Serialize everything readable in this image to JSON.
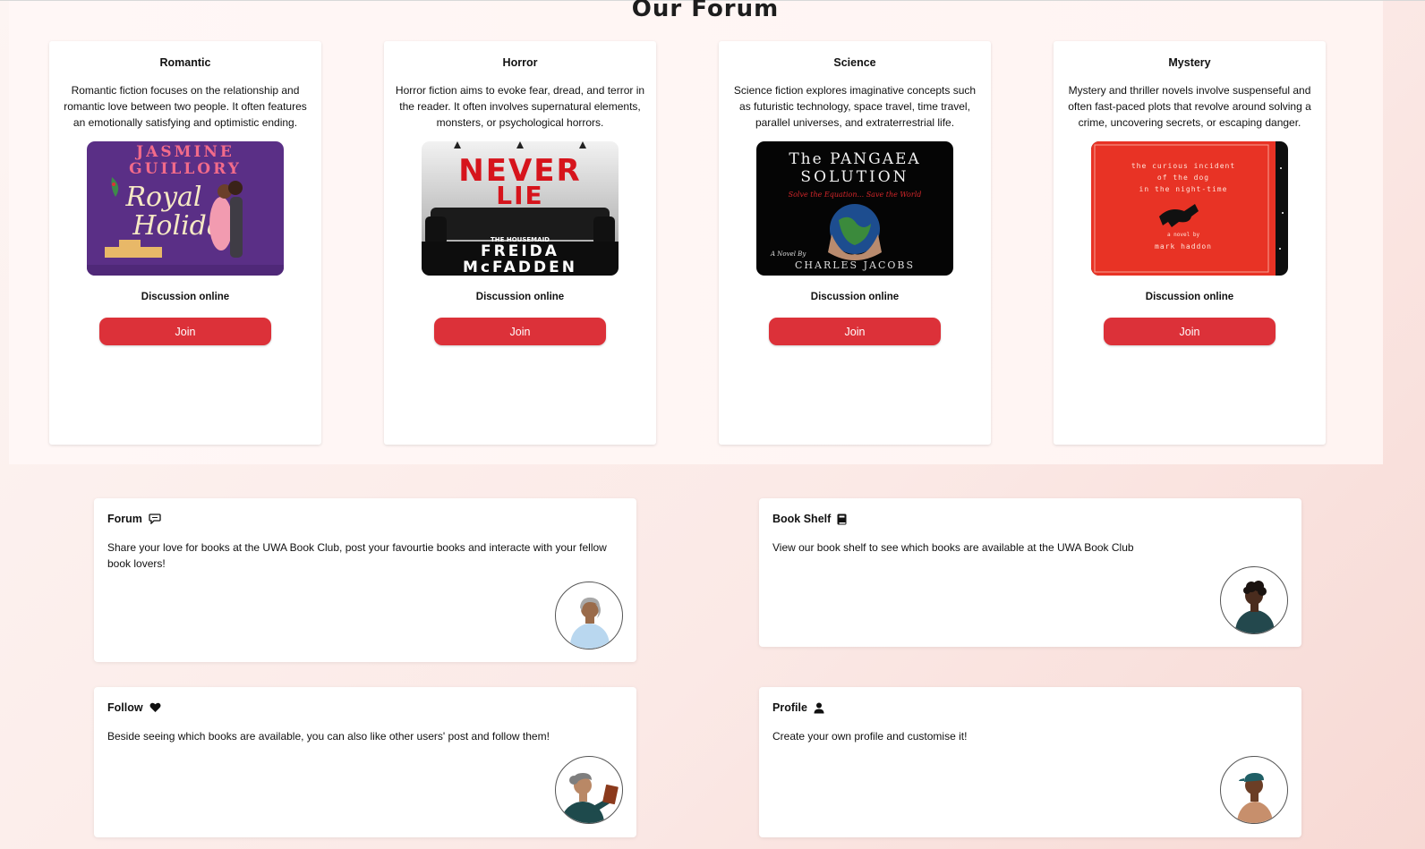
{
  "forum_section": {
    "title": "Our Forum",
    "genres": [
      {
        "title": "Romantic",
        "description": "Romantic fiction focuses on the relationship and romantic love between two people. It often features an emotionally satisfying and optimistic ending.",
        "cover": {
          "author_top": "JASMINE",
          "author_bottom": "GUILLORY",
          "title_line1": "Royal",
          "title_line2": "Holiday"
        },
        "discussion_label": "Discussion online",
        "join_label": "Join"
      },
      {
        "title": "Horror",
        "description": "Horror fiction aims to evoke fear, dread, and terror in the reader. It often involves supernatural elements, monsters, or psychological horrors.",
        "cover": {
          "title_line1": "NEVER",
          "title_line2": "LIE",
          "tagline": "THE HOUSEMAID",
          "author_line1": "FREIDA",
          "author_line2": "McFADDEN"
        },
        "discussion_label": "Discussion online",
        "join_label": "Join"
      },
      {
        "title": "Science",
        "description": "Science fiction explores imaginative concepts such as futuristic technology, space travel, time travel, parallel universes, and extraterrestrial life.",
        "cover": {
          "title_line1": "The PANGAEA",
          "title_line2": "SOLUTION",
          "tagline": "Solve the Equation... Save the World",
          "byline": "A Novel By",
          "author": "CHARLES JACOBS"
        },
        "discussion_label": "Discussion online",
        "join_label": "Join"
      },
      {
        "title": "Mystery",
        "description": "Mystery and thriller novels involve suspenseful and often fast-paced plots that revolve around solving a crime, uncovering secrets, or escaping danger.",
        "cover": {
          "title_line1": "the curious incident",
          "title_line2": "of the dog",
          "title_line3": "in the night-time",
          "byline": "a novel by",
          "author": "mark haddon"
        },
        "discussion_label": "Discussion online",
        "join_label": "Join"
      }
    ]
  },
  "features": [
    {
      "title": "Forum",
      "icon": "chat-icon",
      "text": "Share your love for books at the UWA Book Club, post your favourtie books and interacte with your fellow book lovers!",
      "avatar": "avatar-older-person"
    },
    {
      "title": "Book Shelf",
      "icon": "book-icon",
      "text": "View our book shelf to see which books are available at the UWA Book Club",
      "avatar": "avatar-person-curly-hair"
    },
    {
      "title": "Follow",
      "icon": "heart-icon",
      "text": "Beside seeing which books are available, you can also like other users' post and follow them!",
      "avatar": "avatar-person-with-book"
    },
    {
      "title": "Profile",
      "icon": "user-icon",
      "text": "Create your own profile and customise it!",
      "avatar": "avatar-person-with-cap"
    }
  ],
  "colors": {
    "accent": "#dc3139",
    "card_bg": "#ffffff",
    "page_bg": "#fbe9e6"
  }
}
